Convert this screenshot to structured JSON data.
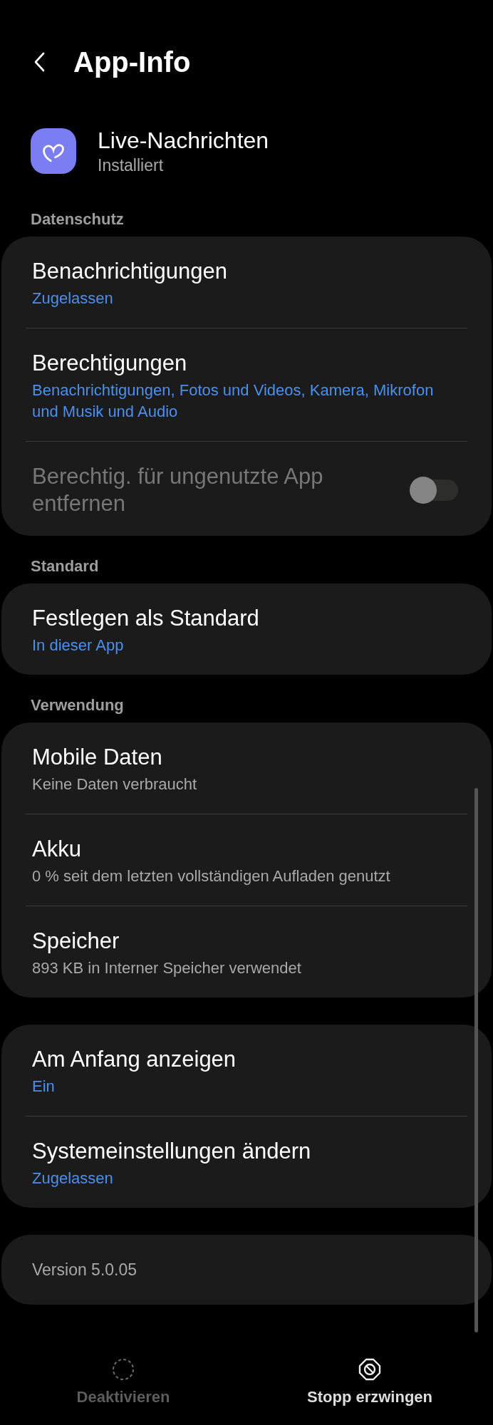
{
  "header": {
    "title": "App-Info"
  },
  "app": {
    "name": "Live-Nachrichten",
    "status": "Installiert"
  },
  "sections": [
    {
      "label": "Datenschutz",
      "cards": [
        [
          {
            "kind": "text",
            "title": "Benachrichtigungen",
            "subtitle": "Zugelassen",
            "highlighted": true,
            "disabled": false
          },
          {
            "kind": "text",
            "title": "Berechtigungen",
            "subtitle": "Benachrichtigungen, Fotos und Videos, Kamera, Mikrofon und Musik und Audio",
            "highlighted": true,
            "disabled": false
          },
          {
            "kind": "toggle",
            "title": "Berechtig. für ungenutzte App entfernen",
            "on": false,
            "disabled": true
          }
        ]
      ]
    },
    {
      "label": "Standard",
      "cards": [
        [
          {
            "kind": "text",
            "title": "Festlegen als Standard",
            "subtitle": "In dieser App",
            "highlighted": true,
            "disabled": false
          }
        ]
      ]
    },
    {
      "label": "Verwendung",
      "cards": [
        [
          {
            "kind": "text",
            "title": "Mobile Daten",
            "subtitle": "Keine Daten verbraucht",
            "highlighted": false,
            "disabled": false
          },
          {
            "kind": "text",
            "title": "Akku",
            "subtitle": "0 % seit dem letzten vollständigen Aufladen genutzt",
            "highlighted": false,
            "disabled": false
          },
          {
            "kind": "text",
            "title": "Speicher",
            "subtitle": "893 KB in Interner Speicher verwendet",
            "highlighted": false,
            "disabled": false
          }
        ],
        [
          {
            "kind": "text",
            "title": "Am Anfang anzeigen",
            "subtitle": "Ein",
            "highlighted": true,
            "disabled": false
          },
          {
            "kind": "text",
            "title": "Systemeinstellungen ändern",
            "subtitle": "Zugelassen",
            "highlighted": true,
            "disabled": false
          }
        ],
        [
          {
            "kind": "plain",
            "title": "Version 5.0.05"
          }
        ]
      ]
    }
  ],
  "bottom_actions": [
    {
      "kind": "disable",
      "label": "Deaktivieren",
      "disabled": true
    },
    {
      "kind": "force_stop",
      "label": "Stopp erzwingen",
      "disabled": false
    }
  ]
}
